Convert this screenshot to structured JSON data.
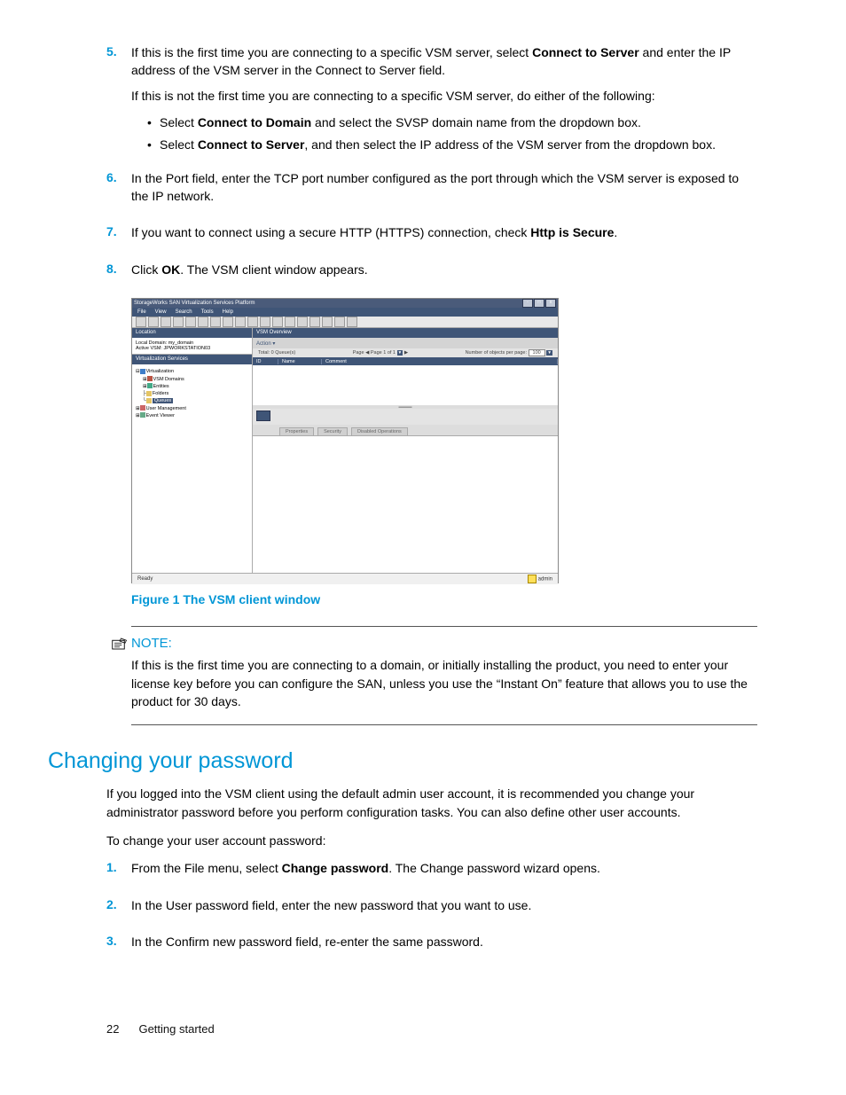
{
  "steps_a": [
    {
      "n": "5.",
      "parts": [
        {
          "type": "para",
          "runs": [
            {
              "t": "If this is the first time you are connecting to a specific VSM server, select "
            },
            {
              "t": "Connect to Server",
              "b": true
            },
            {
              "t": " and enter the IP address of the VSM server in the Connect to Server field."
            }
          ]
        },
        {
          "type": "para",
          "runs": [
            {
              "t": "If this is not the first time you are connecting to a specific VSM server, do either of the following:"
            }
          ]
        },
        {
          "type": "bullets",
          "items": [
            [
              {
                "t": "Select "
              },
              {
                "t": "Connect to Domain",
                "b": true
              },
              {
                "t": " and select the SVSP domain name from the dropdown box."
              }
            ],
            [
              {
                "t": "Select "
              },
              {
                "t": "Connect to Server",
                "b": true
              },
              {
                "t": ", and then select the IP address of the VSM server from the dropdown box."
              }
            ]
          ]
        }
      ]
    },
    {
      "n": "6.",
      "parts": [
        {
          "type": "para",
          "runs": [
            {
              "t": "In the Port field, enter the TCP port number configured as the port through which the VSM server is exposed to the IP network."
            }
          ]
        }
      ]
    },
    {
      "n": "7.",
      "parts": [
        {
          "type": "para",
          "runs": [
            {
              "t": "If you want to connect using a secure HTTP (HTTPS) connection, check "
            },
            {
              "t": "Http is Secure",
              "b": true
            },
            {
              "t": "."
            }
          ]
        }
      ]
    },
    {
      "n": "8.",
      "parts": [
        {
          "type": "para",
          "runs": [
            {
              "t": "Click "
            },
            {
              "t": "OK",
              "b": true
            },
            {
              "t": ". The VSM client window appears."
            }
          ]
        }
      ]
    }
  ],
  "screenshot": {
    "title": "StorageWorks SAN Virtualization Services Platform",
    "menus": [
      "File",
      "View",
      "Search",
      "Tools",
      "Help"
    ],
    "location_hdr": "Location",
    "local_domain_lbl": "Local Domain:",
    "local_domain_val": "my_domain",
    "active_vsm_lbl": "Active VSM:",
    "active_vsm_val": "JPWORKSTATION03",
    "vs_hdr": "Virtualization Services",
    "tree": {
      "root": "Virtualization",
      "c1": "VSM Domains",
      "c2": "Entities",
      "c3": "Folders",
      "c4": "Queues",
      "u1": "User Management",
      "u2": "Event Viewer"
    },
    "vsm_hdr": "VSM Overview",
    "action": "Action ▾",
    "total": "Total: 0 Queue(s)",
    "page_lbl": "Page",
    "page_of": "Page 1 of 1",
    "objs_lbl": "Number of objects per page:",
    "objs_val": "100",
    "th1": "ID",
    "th2": "Name",
    "th3": "Comment",
    "tab1": "Properties",
    "tab2": "Security",
    "tab3": "Disabled Operations",
    "status": "Ready",
    "user": "admin"
  },
  "caption": "Figure 1 The VSM client window",
  "note": {
    "label": "NOTE:",
    "text": "If this is the first time you are connecting to a domain, or initially installing the product, you need to enter your license key before you can configure the SAN, unless you use the “Instant On” feature that allows you to use the product for 30 days."
  },
  "section_heading": "Changing your password",
  "section_intro": "If you logged into the VSM client using the default admin user account, it is recommended you change your administrator password before you perform configuration tasks. You can also define other user accounts.",
  "section_lead": "To change your user account password:",
  "steps_b": [
    {
      "n": "1.",
      "parts": [
        {
          "type": "para",
          "runs": [
            {
              "t": "From the File menu, select "
            },
            {
              "t": "Change password",
              "b": true
            },
            {
              "t": ". The Change password wizard opens."
            }
          ]
        }
      ]
    },
    {
      "n": "2.",
      "parts": [
        {
          "type": "para",
          "runs": [
            {
              "t": "In the User password field, enter the new password that you want to use."
            }
          ]
        }
      ]
    },
    {
      "n": "3.",
      "parts": [
        {
          "type": "para",
          "runs": [
            {
              "t": "In the Confirm new password field, re-enter the same password."
            }
          ]
        }
      ]
    }
  ],
  "footer": {
    "page": "22",
    "chapter": "Getting started"
  }
}
